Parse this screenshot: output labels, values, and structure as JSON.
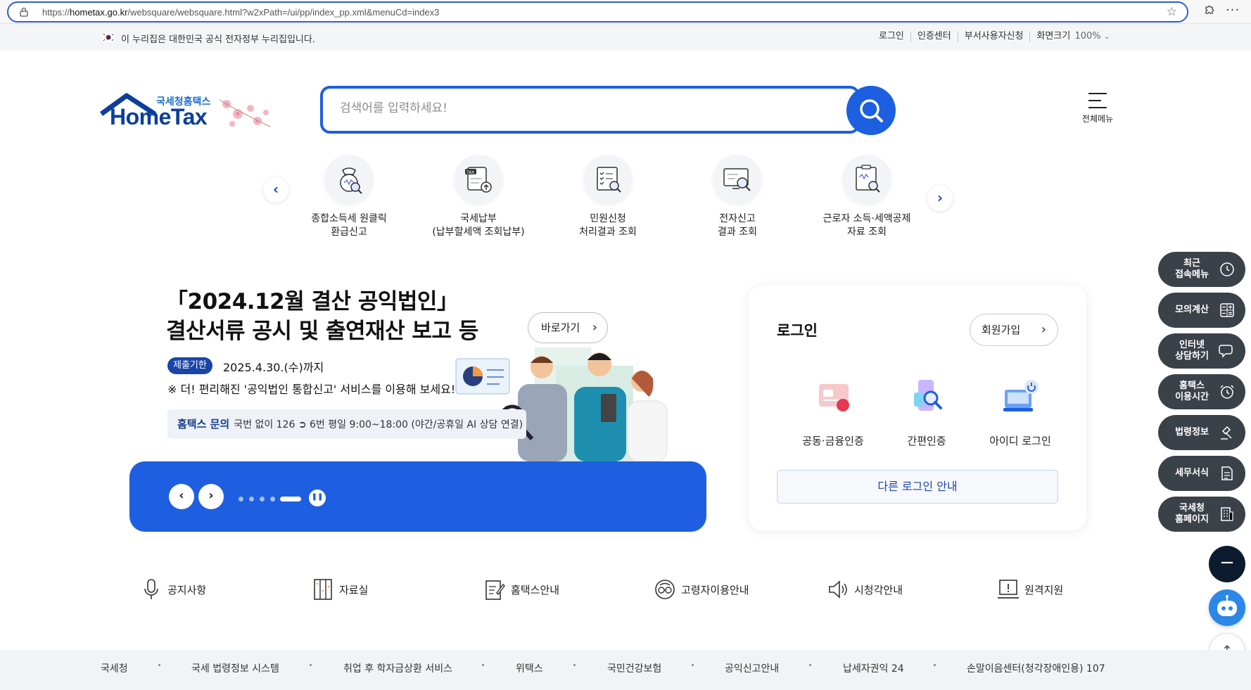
{
  "browser": {
    "url_prefix": "https://",
    "url_host": "hometax.go.kr",
    "url_path": "/websquare/websquare.html?w2xPath=/ui/pp/index_pp.xml&menuCd=index3",
    "more": "···"
  },
  "gov_banner": {
    "message": "이 누리집은 대한민국 공식 전자정부 누리집입니다."
  },
  "util_nav": {
    "login": "로그인",
    "cert_center": "인증센터",
    "dept_user": "부서사용자신청",
    "screen_size": "화면크기",
    "zoom": "100%"
  },
  "header": {
    "logo_sub": "국세청홈택스",
    "logo_main": "HomeTax",
    "search_placeholder": "검색어를 입력하세요!",
    "all_menu": "전체메뉴"
  },
  "quick_menu": [
    {
      "line1": "종합소득세 원클릭",
      "line2": "환급신고"
    },
    {
      "line1": "국세납부",
      "line2": "(납부할세액 조회납부)"
    },
    {
      "line1": "민원신청",
      "line2": "처리결과 조회"
    },
    {
      "line1": "전자신고",
      "line2": "결과 조회"
    },
    {
      "line1": "근로자 소득·세액공제",
      "line2": "자료 조회"
    }
  ],
  "quick_arrows": {
    "prev": "‹",
    "next": "›"
  },
  "banner": {
    "title_line1": "「2024.12월 결산 공익법인」",
    "title_line2": "결산서류 공시 및 출연재산 보고 등",
    "go_label": "바로가기",
    "deadline_badge": "제출기한",
    "deadline": "2025.4.30.(수)까지",
    "note": "※ 더! 편리해진 '공익법인 통합신고' 서비스를 이용해 보세요!",
    "inquiry_label": "홈택스 문의",
    "inquiry_text": "국번 없이 126 ➲ 6번 평일 9:00~18:00 (야간/공휴일 AI 상담 연결)",
    "slide_count": 5,
    "active_slide": 5
  },
  "login": {
    "title": "로그인",
    "signup": "회원가입",
    "options": [
      "공동·금융인증",
      "간편인증",
      "아이디 로그인"
    ],
    "other": "다른 로그인 안내"
  },
  "float_menu": [
    {
      "l1": "최근",
      "l2": "접속메뉴",
      "icon": "clock-icon"
    },
    {
      "l1": "모의계산",
      "l2": "",
      "icon": "calculator-icon"
    },
    {
      "l1": "인터넷",
      "l2": "상담하기",
      "icon": "chat-icon"
    },
    {
      "l1": "홈택스",
      "l2": "이용시간",
      "icon": "alarm-icon"
    },
    {
      "l1": "법령정보",
      "l2": "",
      "icon": "gavel-icon"
    },
    {
      "l1": "세무서식",
      "l2": "",
      "icon": "form-icon"
    },
    {
      "l1": "국세청",
      "l2": "홈페이지",
      "icon": "building-icon"
    }
  ],
  "bottom_links": [
    "공지사항",
    "자료실",
    "홈택스안내",
    "고령자이용안내",
    "시청각안내",
    "원격지원"
  ],
  "footer_links": [
    "국세청",
    "국세 법령정보 시스템",
    "취업 후 학자금상환 서비스",
    "위택스",
    "국민건강보험",
    "공익신고안내",
    "납세자권익 24",
    "손말이음센터(청각장애인용) 107"
  ],
  "colors": {
    "primary_blue": "#1d5fe0",
    "navy": "#1a45a8",
    "float_bg": "#3b4149"
  }
}
